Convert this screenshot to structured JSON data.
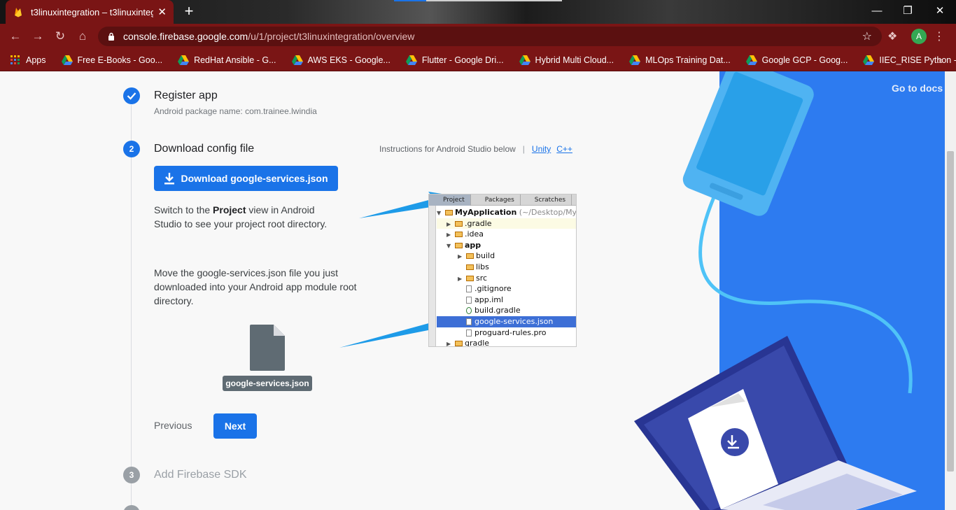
{
  "browser": {
    "tab_title": "t3linuxintegration – t3linuxintegr",
    "tab_close": "✕",
    "new_tab": "+",
    "url_host": "console.firebase.google.com",
    "url_path": "/u/1/project/t3linuxintegration/overview",
    "avatar_letter": "A",
    "bookmarks": [
      "Apps",
      "Free E-Books - Goo...",
      "RedHat Ansible - G...",
      "AWS EKS - Google...",
      "Flutter - Google Dri...",
      "Hybrid Multi Cloud...",
      "MLOps Training Dat...",
      "Google GCP - Goog...",
      "IIEC_RISE Python -..."
    ],
    "bookmarks_more": "»"
  },
  "steps": {
    "step1": {
      "title": "Register app",
      "subtitle": "Android package name: com.trainee.lwindia"
    },
    "step2": {
      "number": "2",
      "title": "Download config file"
    },
    "step3": {
      "number": "3",
      "title": "Add Firebase SDK"
    }
  },
  "instructions": {
    "text": "Instructions for Android Studio below",
    "separator": "|",
    "unity": "Unity",
    "cpp": "C++"
  },
  "download_button": "Download google-services.json",
  "para1_prefix": "Switch to the ",
  "para1_bold": "Project",
  "para1_suffix": " view in Android Studio to see your project root directory.",
  "para2": "Move the google-services.json file you just downloaded into your Android app module root directory.",
  "file_label": "google-services.json",
  "nav": {
    "previous": "Previous",
    "next": "Next"
  },
  "go_to_docs": "Go to docs",
  "ide": {
    "tabs": [
      "Project",
      "Packages",
      "Scratches"
    ],
    "tree": [
      {
        "label": "MyApplication",
        "extra": " (~/Desktop/My"
      },
      {
        "label": ".gradle"
      },
      {
        "label": ".idea"
      },
      {
        "label": "app"
      },
      {
        "label": "build"
      },
      {
        "label": "libs"
      },
      {
        "label": "src"
      },
      {
        "label": ".gitignore"
      },
      {
        "label": "app.iml"
      },
      {
        "label": "build.gradle"
      },
      {
        "label": "google-services.json"
      },
      {
        "label": "proguard-rules.pro"
      },
      {
        "label": "gradle"
      }
    ]
  },
  "colors": {
    "accent": "#1a73e8",
    "tab_bg": "#7a1515",
    "illustration_bg": "#2d7bf0"
  }
}
